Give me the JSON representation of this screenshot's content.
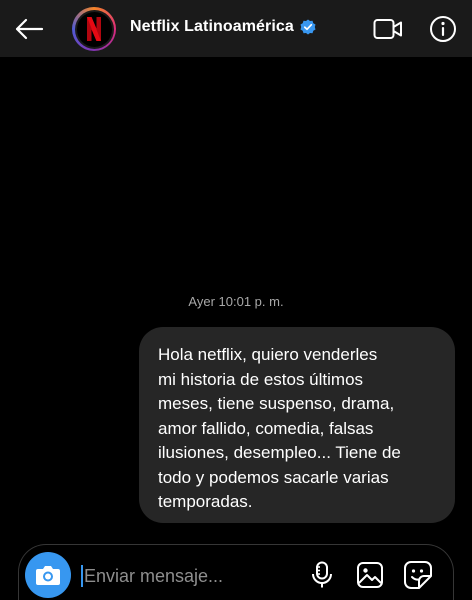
{
  "header": {
    "title": "Netflix Latinoamérica",
    "avatar_letter": "N",
    "brand_color": "#e50914",
    "verified_color": "#3897f0",
    "icons": [
      "back-arrow-icon",
      "verified-badge-icon",
      "video-call-icon",
      "info-icon"
    ]
  },
  "thread": {
    "timestamp": "Ayer 10:01 p. m.",
    "messages": [
      {
        "sender": "me",
        "text": "Hola netflix, quiero venderles\nmi historia de estos últimos\nmeses, tiene suspenso, drama,\namor fallido, comedia, falsas\nilusiones, desempleo... Tiene de\ntodo y podemos sacarle varias\ntemporadas."
      }
    ]
  },
  "composer": {
    "placeholder": "Enviar mensaje...",
    "value": "",
    "accent_color": "#3797f0",
    "icons": [
      "camera-icon",
      "microphone-icon",
      "gallery-icon",
      "sticker-icon"
    ]
  }
}
